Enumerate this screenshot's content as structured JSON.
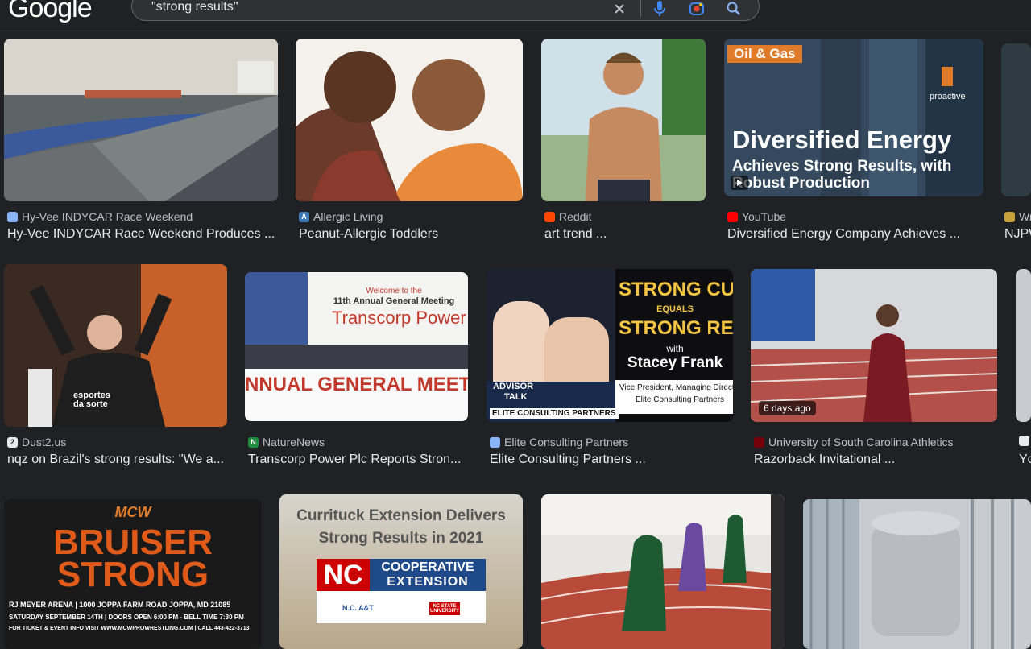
{
  "header": {
    "logo": "Google",
    "query": "\"strong results\""
  },
  "row1": [
    {
      "source": "Hy-Vee INDYCAR Race Weekend",
      "title": "Hy-Vee INDYCAR Race Weekend Produces ..."
    },
    {
      "source": "Allergic Living",
      "title": "Peanut-Allergic Toddlers"
    },
    {
      "source": "Reddit",
      "title": "art trend ..."
    },
    {
      "source": "YouTube",
      "title": "Diversified Energy Company Achieves ...",
      "thumb": {
        "tag": "Oil & Gas",
        "brand": "proactive",
        "headline": "Diversified Energy",
        "subline": "Achieves Strong Results, with",
        "subline2": "Robust Production"
      }
    },
    {
      "source": "Wr",
      "title": "NJPW"
    }
  ],
  "row2": [
    {
      "source": "Dust2.us",
      "title": "nqz on Brazil's strong results: \"We a...",
      "thumb": {
        "shirt": "esportes da sorte"
      }
    },
    {
      "source": "NatureNews",
      "title": "Transcorp Power Plc Reports Stron...",
      "thumb": {
        "welcome": "Welcome to the",
        "meeting": "11th Annual General Meeting",
        "brand": "Transcorp Power",
        "banner": "NNUAL GENERAL MEET"
      }
    },
    {
      "source": "Elite Consulting Partners",
      "title": "Elite Consulting Partners ...",
      "thumb": {
        "line1": "STRONG CULTURE",
        "line2": "EQUALS",
        "line3": "STRONG RESULTS",
        "with": "with",
        "name": "Stacey Frank",
        "role1": "Vice President, Managing Direct",
        "role2": "Elite Consulting Partners",
        "advisor1": "ADVISOR",
        "advisor2": "TALK",
        "footer": "ELITE CONSULTING PARTNERS"
      }
    },
    {
      "source": "University of South Carolina Athletics",
      "title": "Razorback Invitational ...",
      "badge": "6 days ago"
    },
    {
      "source": "",
      "title": "Yc"
    }
  ],
  "row3": [
    {
      "thumb": {
        "logo": "MCW",
        "line1": "BRUISER",
        "line2": "STRONG",
        "venue": "RJ MEYER ARENA | 1000 JOPPA FARM ROAD   JOPPA, MD 21085",
        "date": "SATURDAY SEPTEMBER 14TH | DOORS OPEN 6:00 PM - BELL TIME 7:30 PM",
        "info": "FOR TICKET & EVENT INFO VISIT WWW.MCWPROWRESTLING.COM | CALL 443-422-3713"
      }
    },
    {
      "thumb": {
        "headline1": "Currituck Extension Delivers",
        "headline2": "Strong Results in 2021",
        "nc": "NC",
        "coop1": "COOPERATIVE",
        "coop2": "EXTENSION",
        "uni1": "N.C. A&T",
        "uni2": "NC STATE UNIVERSITY"
      }
    },
    {
      "thumb": {}
    },
    {
      "thumb": {}
    }
  ]
}
